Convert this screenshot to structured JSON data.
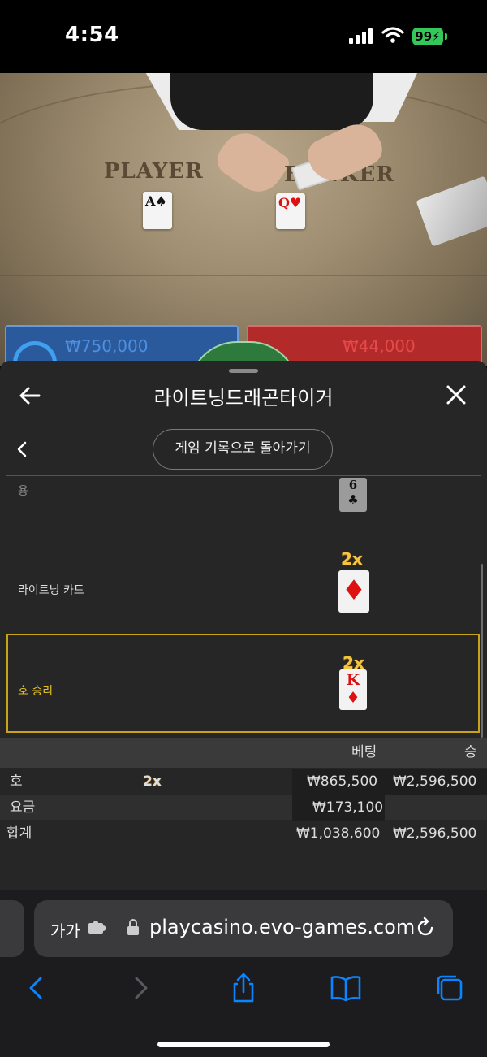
{
  "status": {
    "time": "4:54",
    "battery": "99"
  },
  "game": {
    "player_label": "PLAYER",
    "banker_label": "BANKER",
    "card_a": "A",
    "card_q": "Q",
    "bet_blue": "₩750,000",
    "bet_red": "₩44,000"
  },
  "sheet": {
    "title": "라이트닝드래곤타이거",
    "history_button": "게임 기록으로 돌아가기",
    "rows": [
      {
        "label": "용",
        "card": "6",
        "suit": "♣"
      },
      {
        "label": "라이트닝 카드",
        "multiplier": "2x",
        "suit": "♦"
      },
      {
        "label": "호 승리",
        "multiplier": "2x",
        "card": "K",
        "suit": "♦"
      }
    ],
    "table": {
      "headers": [
        "베팅",
        "승"
      ],
      "rows": [
        {
          "label": "호",
          "multiplier": "2x",
          "bet": "₩865,500",
          "win": "₩2,596,500"
        },
        {
          "label": "요금",
          "bet": "₩173,100",
          "win": ""
        },
        {
          "label": "합계",
          "bet": "₩1,038,600",
          "win": "₩2,596,500"
        }
      ]
    }
  },
  "browser": {
    "text_size": "가가",
    "url": "playcasino.evo-games.com",
    "icons": [
      "puzzle-icon",
      "lock-icon",
      "reload-icon",
      "back-icon",
      "forward-icon",
      "share-icon",
      "bookmarks-icon",
      "tabs-icon"
    ]
  },
  "colors": {
    "accent_gold": "#c9a41a",
    "battery": "#34c759",
    "ios_blue": "#0a84ff"
  }
}
